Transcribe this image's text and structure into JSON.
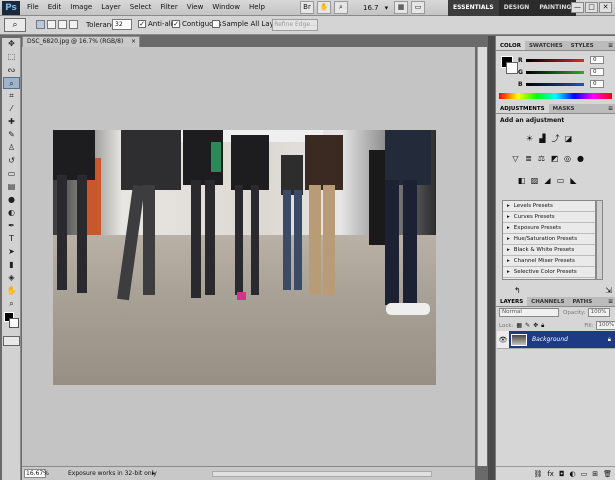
{
  "app": {
    "logo": "Ps"
  },
  "menu": [
    "File",
    "Edit",
    "Image",
    "Layer",
    "Select",
    "Filter",
    "View",
    "Window",
    "Help"
  ],
  "topbar": {
    "zoom": "16.7",
    "zoom_arrow": "▾",
    "workspaces": [
      "ESSENTIALS",
      "DESIGN",
      "PAINTING"
    ],
    "win": [
      "—",
      "□",
      "✕"
    ]
  },
  "options": {
    "tolerance_label": "Tolerance:",
    "tolerance_value": "32",
    "anti_alias": "Anti-alias",
    "contiguous": "Contiguous",
    "sample_all": "Sample All Layers",
    "refine_edge": "Refine Edge..."
  },
  "document": {
    "tab_title": "DSC_6820.jpg @ 16.7% (RGB/8)",
    "close": "×"
  },
  "status": {
    "zoom": "16.67%",
    "text": "Exposure works in 32-bit only",
    "arrow": "▸"
  },
  "color_panel": {
    "tabs": [
      "COLOR",
      "SWATCHES",
      "STYLES"
    ],
    "channels": [
      {
        "label": "R",
        "value": "0",
        "color": "#e0262a"
      },
      {
        "label": "G",
        "value": "0",
        "color": "#2aa83a"
      },
      {
        "label": "B",
        "value": "0",
        "color": "#2a4ad0"
      }
    ]
  },
  "adjustments_panel": {
    "tabs": [
      "ADJUSTMENTS",
      "MASKS"
    ],
    "title": "Add an adjustment",
    "presets": [
      "Levels Presets",
      "Curves Presets",
      "Exposure Presets",
      "Hue/Saturation Presets",
      "Black & White Presets",
      "Channel Mixer Presets",
      "Selective Color Presets"
    ]
  },
  "layers_panel": {
    "tabs": [
      "LAYERS",
      "CHANNELS",
      "PATHS"
    ],
    "blend_mode": "Normal",
    "opacity_label": "Opacity:",
    "opacity_value": "100%",
    "lock_label": "Lock:",
    "fill_label": "Fill:",
    "fill_value": "100%",
    "layer_name": "Background"
  },
  "colors": {
    "selection": "#1d3a84",
    "accent": "#4aa3e0"
  }
}
